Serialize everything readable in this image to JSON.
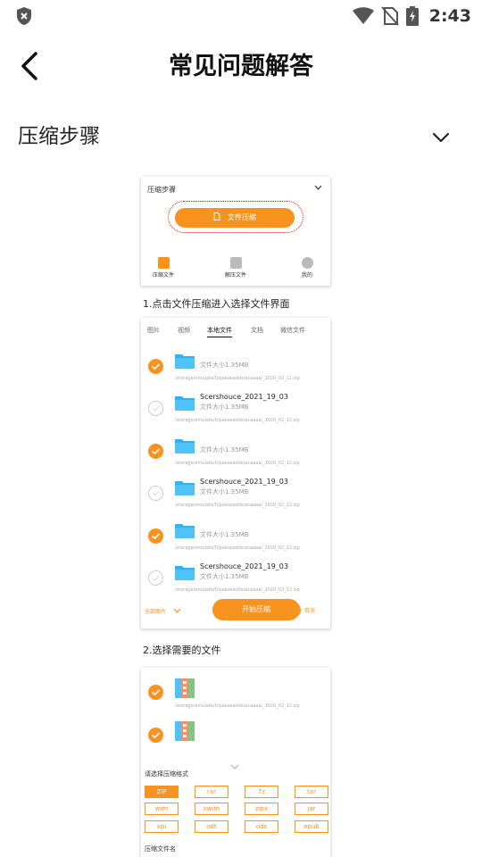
{
  "status_bar": {
    "time": "2:43"
  },
  "header": {
    "title": "常见问题解答"
  },
  "section": {
    "title": "压缩步骤"
  },
  "card1": {
    "title": "压缩步骤",
    "button": "文件压缩",
    "nav": [
      "压缩文件",
      "解压文件",
      "我的"
    ],
    "caption": "1.点击文件压缩进入选择文件界面"
  },
  "card2": {
    "tabs": [
      "图片",
      "视频",
      "本地文件",
      "文档",
      "微信文件"
    ],
    "active_tab": "本地文件",
    "files": [
      {
        "name": "",
        "size": "文件大小1.35MB",
        "path": "/storage/emulate/0/pakoeadds/acaaaa/_2020_02_12.zip",
        "checked": true
      },
      {
        "name": "Scershouce_2021_19_03",
        "size": "文件大小1.35MB",
        "path": "/storage/emulate/0/pakoeadds/acaaaa/_2020_02_12.zip",
        "checked": false
      },
      {
        "name": "",
        "size": "文件大小1.35MB",
        "path": "/storage/emulate/0/pakoeadds/acaaaa/_2020_02_12.zip",
        "checked": true
      },
      {
        "name": "Scershouce_2021_19_03",
        "size": "文件大小1.35MB",
        "path": "/storage/emulate/0/pakoeadds/acaaaa/_2020_02_12.zip",
        "checked": false
      },
      {
        "name": "",
        "size": "文件大小1.35MB",
        "path": "/storage/emulate/0/pakoeadds/acaaaa/_2020_02_12.zip",
        "checked": true
      },
      {
        "name": "Scershouce_2021_19_03",
        "size": "文件大小1.35MB",
        "path": "/storage/emulate/0/pakoeadds/acaaaa/_2020_02_12.zip",
        "checked": false
      }
    ],
    "select_all": "全部图片",
    "start_button": "开始压缩",
    "cancel": "取消",
    "caption": "2.选择需要的文件"
  },
  "card3": {
    "paths": [
      "/storage/emulate/0/pakoeadds/acaaaa/_2020_02_12.zip"
    ],
    "format_title": "请选择压缩格式",
    "formats": [
      "ZIP",
      "rar",
      "7z",
      "tar",
      "wim",
      "swim",
      "zipx",
      "jar",
      "xpi",
      "odt",
      "ods",
      "epub"
    ],
    "selected_format": "ZIP",
    "name_title": "压缩文件名"
  },
  "colors": {
    "accent": "#f7931e",
    "folder": "#29b6f6"
  }
}
